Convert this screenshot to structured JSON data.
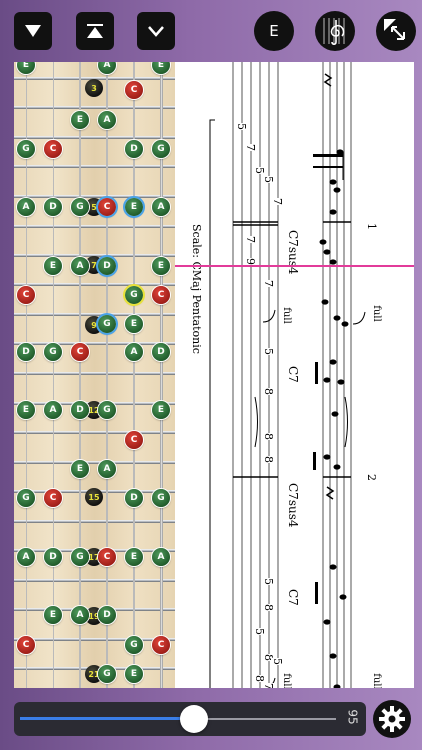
{
  "toolbar": {
    "e_button_label": "E",
    "icons": [
      "play-down-icon",
      "skip-to-top-icon",
      "chevron-down-icon",
      "treble-clef-icon",
      "expand-icon"
    ]
  },
  "fretboard": {
    "fret_markers": [
      "3",
      "5",
      "7",
      "9",
      "12",
      "15",
      "17",
      "19",
      "21"
    ],
    "notes": [
      {
        "n": "E",
        "c": "g"
      },
      {
        "n": "A",
        "c": "g"
      },
      {
        "n": "E",
        "c": "g"
      },
      {
        "n": "C",
        "c": "r"
      },
      {
        "n": "E",
        "c": "g"
      },
      {
        "n": "A",
        "c": "g"
      },
      {
        "n": "G",
        "c": "g"
      },
      {
        "n": "C",
        "c": "r"
      },
      {
        "n": "D",
        "c": "g"
      },
      {
        "n": "G",
        "c": "g"
      },
      {
        "n": "A",
        "c": "g"
      },
      {
        "n": "D",
        "c": "g"
      },
      {
        "n": "G",
        "c": "g"
      },
      {
        "n": "C",
        "c": "r"
      },
      {
        "n": "E",
        "c": "g"
      },
      {
        "n": "A",
        "c": "g"
      },
      {
        "n": "E",
        "c": "g"
      },
      {
        "n": "A",
        "c": "g"
      },
      {
        "n": "D",
        "c": "g"
      },
      {
        "n": "E",
        "c": "g"
      },
      {
        "n": "C",
        "c": "r"
      },
      {
        "n": "G",
        "c": "g"
      },
      {
        "n": "C",
        "c": "r"
      },
      {
        "n": "G",
        "c": "g"
      },
      {
        "n": "E",
        "c": "g"
      },
      {
        "n": "D",
        "c": "g"
      },
      {
        "n": "G",
        "c": "g"
      },
      {
        "n": "C",
        "c": "r"
      },
      {
        "n": "A",
        "c": "g"
      },
      {
        "n": "D",
        "c": "g"
      },
      {
        "n": "E",
        "c": "g"
      },
      {
        "n": "A",
        "c": "g"
      },
      {
        "n": "D",
        "c": "g"
      },
      {
        "n": "G",
        "c": "g"
      },
      {
        "n": "E",
        "c": "g"
      },
      {
        "n": "C",
        "c": "r"
      },
      {
        "n": "E",
        "c": "g"
      },
      {
        "n": "A",
        "c": "g"
      },
      {
        "n": "G",
        "c": "g"
      },
      {
        "n": "C",
        "c": "r"
      },
      {
        "n": "D",
        "c": "g"
      },
      {
        "n": "G",
        "c": "g"
      },
      {
        "n": "A",
        "c": "g"
      },
      {
        "n": "D",
        "c": "g"
      },
      {
        "n": "G",
        "c": "g"
      },
      {
        "n": "C",
        "c": "r"
      },
      {
        "n": "E",
        "c": "g"
      },
      {
        "n": "A",
        "c": "g"
      },
      {
        "n": "E",
        "c": "g"
      },
      {
        "n": "A",
        "c": "g"
      },
      {
        "n": "D",
        "c": "g"
      },
      {
        "n": "C",
        "c": "r"
      },
      {
        "n": "G",
        "c": "g"
      },
      {
        "n": "C",
        "c": "r"
      },
      {
        "n": "G",
        "c": "g"
      },
      {
        "n": "E",
        "c": "g"
      }
    ]
  },
  "score": {
    "scale_label": "Scale: CMaj Pentatonic",
    "chords": [
      "C7sus4",
      "C7",
      "C7sus4",
      "C7"
    ],
    "measure_numbers": [
      "1",
      "2"
    ],
    "bend_labels": [
      "full",
      "full",
      "full",
      "full"
    ],
    "tab_numbers": [
      "5",
      "7",
      "5",
      "5",
      "7",
      "7",
      "9",
      "7",
      "5",
      "8",
      "8",
      "8",
      "5",
      "8",
      "5",
      "8",
      "5",
      "8",
      "7"
    ]
  },
  "transport": {
    "tempo": "95",
    "position": 0.55,
    "accent": "#3a7ee8"
  },
  "colors": {
    "background": "#8e6aa8",
    "playhead": "#e23b9a",
    "note_green": "#2e7a3c",
    "note_red": "#c02a22",
    "highlight_blue": "#4aa3e8",
    "highlight_yellow": "#e8e23a"
  }
}
